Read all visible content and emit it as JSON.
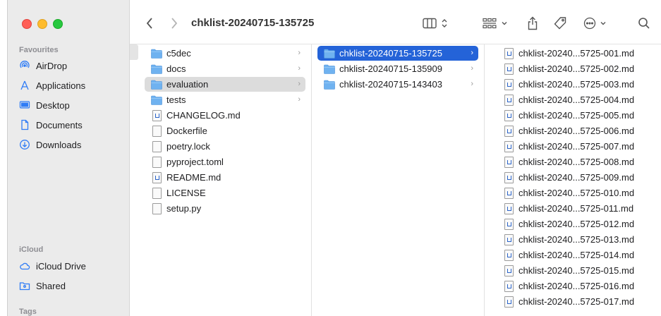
{
  "window": {
    "title": "chklist-20240715-135725"
  },
  "sidebar": {
    "sections": {
      "favourites": "Favourites",
      "icloud": "iCloud",
      "tags": "Tags"
    },
    "favourites": [
      {
        "label": "AirDrop",
        "icon": "airdrop-icon"
      },
      {
        "label": "Applications",
        "icon": "applications-icon"
      },
      {
        "label": "Desktop",
        "icon": "desktop-icon"
      },
      {
        "label": "Documents",
        "icon": "document-icon"
      },
      {
        "label": "Downloads",
        "icon": "download-icon"
      }
    ],
    "icloud": [
      {
        "label": "iCloud Drive",
        "icon": "cloud-icon"
      },
      {
        "label": "Shared",
        "icon": "shared-folder-icon"
      }
    ]
  },
  "column1": [
    {
      "name": "c5dec",
      "type": "folder"
    },
    {
      "name": "docs",
      "type": "folder"
    },
    {
      "name": "evaluation",
      "type": "folder"
    },
    {
      "name": "tests",
      "type": "folder"
    },
    {
      "name": "CHANGELOG.md",
      "type": "md"
    },
    {
      "name": "Dockerfile",
      "type": "file"
    },
    {
      "name": "poetry.lock",
      "type": "file"
    },
    {
      "name": "pyproject.toml",
      "type": "file"
    },
    {
      "name": "README.md",
      "type": "md"
    },
    {
      "name": "LICENSE",
      "type": "file"
    },
    {
      "name": "setup.py",
      "type": "file"
    }
  ],
  "column2": [
    {
      "name": "chklist-20240715-135725"
    },
    {
      "name": "chklist-20240715-135909"
    },
    {
      "name": "chklist-20240715-143403"
    }
  ],
  "column3": [
    "chklist-20240...5725-001.md",
    "chklist-20240...5725-002.md",
    "chklist-20240...5725-003.md",
    "chklist-20240...5725-004.md",
    "chklist-20240...5725-005.md",
    "chklist-20240...5725-006.md",
    "chklist-20240...5725-007.md",
    "chklist-20240...5725-008.md",
    "chklist-20240...5725-009.md",
    "chklist-20240...5725-010.md",
    "chklist-20240...5725-011.md",
    "chklist-20240...5725-012.md",
    "chklist-20240...5725-013.md",
    "chklist-20240...5725-014.md",
    "chklist-20240...5725-015.md",
    "chklist-20240...5725-016.md",
    "chklist-20240...5725-017.md"
  ],
  "colors": {
    "folder": "#6fb2f0",
    "selection": "#2463d8",
    "accent": "#2f7cf6"
  }
}
